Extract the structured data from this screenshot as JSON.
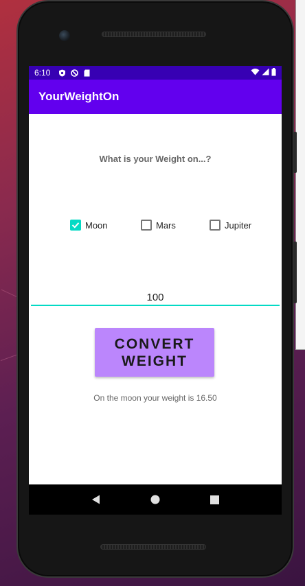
{
  "status_bar": {
    "time": "6:10",
    "icons_left": [
      "shield-icon",
      "blocked-icon",
      "sd-card-icon"
    ],
    "icons_right": [
      "wifi-icon",
      "signal-icon",
      "battery-icon"
    ]
  },
  "app_bar": {
    "title": "YourWeightOn"
  },
  "main": {
    "question": "What is your Weight on...?",
    "planets": [
      {
        "label": "Moon",
        "checked": true
      },
      {
        "label": "Mars",
        "checked": false
      },
      {
        "label": "Jupiter",
        "checked": false
      }
    ],
    "weight_input": {
      "value": "100"
    },
    "convert_button": {
      "label": "CONVERT\nWEIGHT"
    },
    "result_text": "On the moon your weight is 16.50"
  },
  "nav_bar": {
    "buttons": [
      "back-icon",
      "home-icon",
      "recents-icon"
    ]
  },
  "colors": {
    "status_bar": "#3700b3",
    "app_bar": "#6200ee",
    "accent": "#03dac5",
    "button": "#bb86fc"
  }
}
